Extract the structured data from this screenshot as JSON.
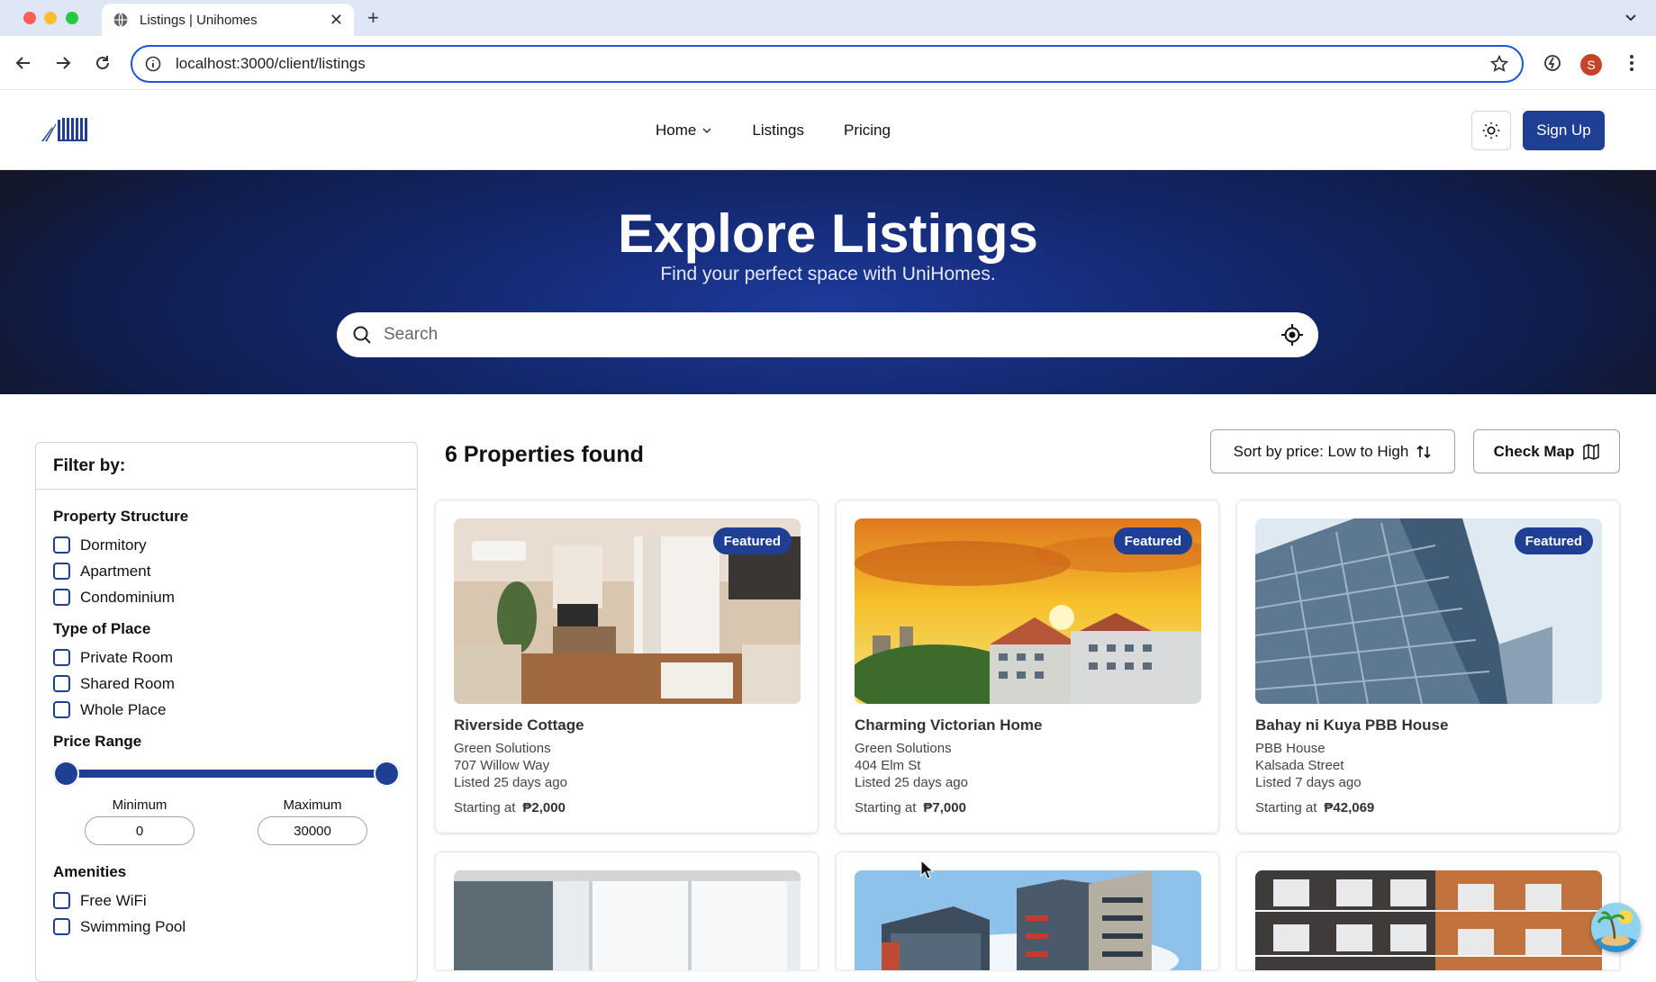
{
  "browser": {
    "tab_title": "Listings | Unihomes",
    "url": "localhost:3000/client/listings",
    "profile_initial": "S"
  },
  "header": {
    "nav": [
      {
        "label": "Home"
      },
      {
        "label": "Listings"
      },
      {
        "label": "Pricing"
      }
    ],
    "signup_label": "Sign Up",
    "brand_color": "#1e3f94"
  },
  "hero": {
    "title": "Explore Listings",
    "subtitle": "Find your perfect space with UniHomes.",
    "search_placeholder": "Search"
  },
  "filters": {
    "heading": "Filter by:",
    "property_structure": {
      "title": "Property Structure",
      "options": [
        "Dormitory",
        "Apartment",
        "Condominium"
      ]
    },
    "type_of_place": {
      "title": "Type of Place",
      "options": [
        "Private Room",
        "Shared Room",
        "Whole Place"
      ]
    },
    "price_range": {
      "title": "Price Range",
      "min_label": "Minimum",
      "max_label": "Maximum",
      "min_value": "0",
      "max_value": "30000"
    },
    "amenities": {
      "title": "Amenities",
      "options": [
        "Free WiFi",
        "Swimming Pool"
      ]
    }
  },
  "results": {
    "count_label": "6 Properties found",
    "sort_label": "Sort by price: Low to High",
    "map_label": "Check Map",
    "cards": [
      {
        "badge": "Featured",
        "name": "Riverside Cottage",
        "company": "Green Solutions",
        "address": "707 Willow Way",
        "listed": "Listed 25 days ago",
        "price_prefix": "Starting at",
        "price": "₱2,000"
      },
      {
        "badge": "Featured",
        "name": "Charming Victorian Home",
        "company": "Green Solutions",
        "address": "404 Elm St",
        "listed": "Listed 25 days ago",
        "price_prefix": "Starting at",
        "price": "₱7,000"
      },
      {
        "badge": "Featured",
        "name": "Bahay ni Kuya PBB House",
        "company": "PBB House",
        "address": "Kalsada Street",
        "listed": "Listed 7 days ago",
        "price_prefix": "Starting at",
        "price": "₱42,069"
      }
    ]
  }
}
